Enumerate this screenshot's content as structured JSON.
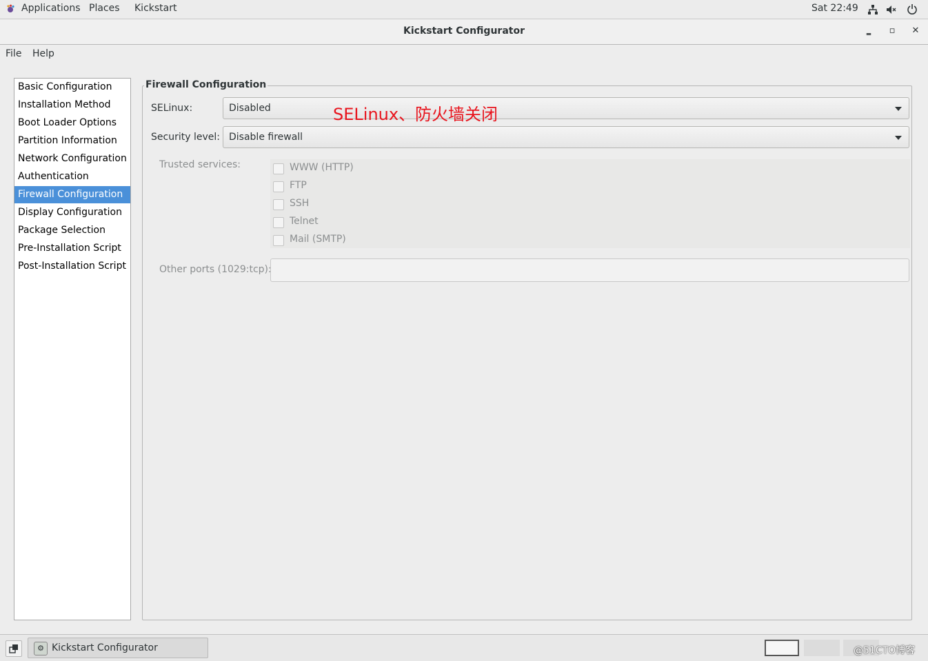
{
  "topbar": {
    "applications": "Applications",
    "places": "Places",
    "kickstart": "Kickstart",
    "clock": "Sat 22:49",
    "icons": [
      "network-icon",
      "volume-muted-icon",
      "power-icon"
    ]
  },
  "window": {
    "title": "Kickstart Configurator",
    "minimize": "‗",
    "maximize": "▫",
    "close": "✕"
  },
  "menu": {
    "file": "File",
    "help": "Help"
  },
  "sidebar": {
    "items": [
      {
        "label": "Basic Configuration"
      },
      {
        "label": "Installation Method"
      },
      {
        "label": "Boot Loader Options"
      },
      {
        "label": "Partition Information"
      },
      {
        "label": "Network Configuration"
      },
      {
        "label": "Authentication"
      },
      {
        "label": "Firewall Configuration"
      },
      {
        "label": "Display Configuration"
      },
      {
        "label": "Package Selection"
      },
      {
        "label": "Pre-Installation Script"
      },
      {
        "label": "Post-Installation Script"
      }
    ],
    "selected": "Firewall Configuration"
  },
  "firewall": {
    "section_title": "Firewall Configuration",
    "selinux_label": "SELinux:",
    "selinux_value": "Disabled",
    "security_level_label": "Security level:",
    "security_level_value": "Disable firewall",
    "trusted_services_label": "Trusted services:",
    "services": [
      {
        "label": "WWW (HTTP)",
        "checked": false
      },
      {
        "label": "FTP",
        "checked": false
      },
      {
        "label": "SSH",
        "checked": false
      },
      {
        "label": "Telnet",
        "checked": false
      },
      {
        "label": "Mail (SMTP)",
        "checked": false
      }
    ],
    "other_ports_label": "Other ports (1029:tcp):",
    "other_ports_value": ""
  },
  "annotation": "SELinux、防火墙关闭",
  "taskbar": {
    "task_label": "Kickstart Configurator",
    "watermark": "@51CTO博客"
  },
  "colors": {
    "selection": "#4a90d9",
    "annotation": "#e8141d"
  }
}
